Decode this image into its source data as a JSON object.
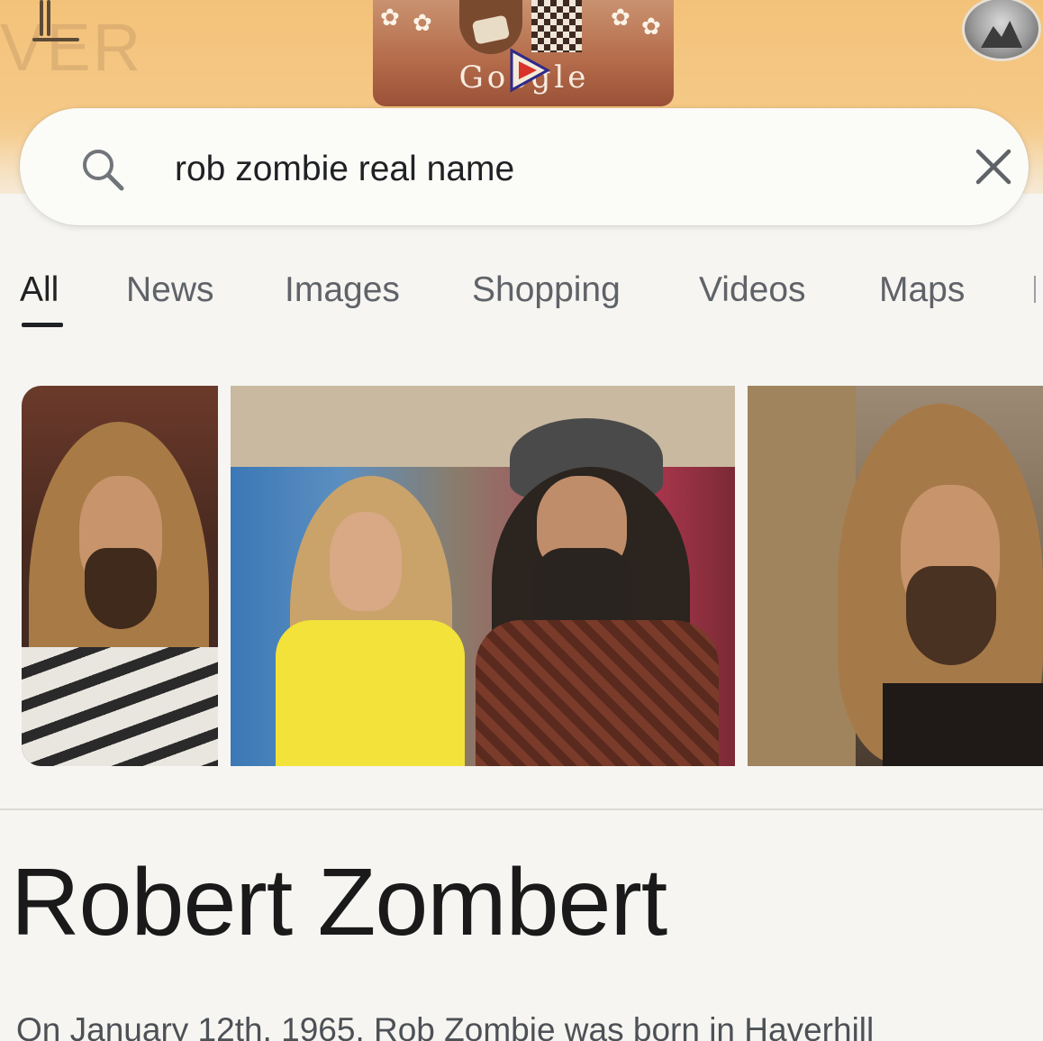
{
  "search": {
    "query": "rob zombie real name"
  },
  "doodle": {
    "wordmark": "Google"
  },
  "watermark": {
    "text": "VER"
  },
  "tabs": [
    {
      "label": "All",
      "active": true
    },
    {
      "label": "News",
      "active": false
    },
    {
      "label": "Images",
      "active": false
    },
    {
      "label": "Shopping",
      "active": false
    },
    {
      "label": "Videos",
      "active": false
    },
    {
      "label": "Maps",
      "active": false
    }
  ],
  "result": {
    "title": "Robert Zombert",
    "snippet": "On January 12th, 1965, Rob Zombie was born in Haverhill"
  },
  "icons": [
    "menu-icon",
    "search-icon",
    "clear-icon",
    "avatar",
    "play-icon"
  ],
  "colors": {
    "header_band": "#f3c27a",
    "tab_active": "#202124",
    "tab_inactive": "#5f6368"
  }
}
